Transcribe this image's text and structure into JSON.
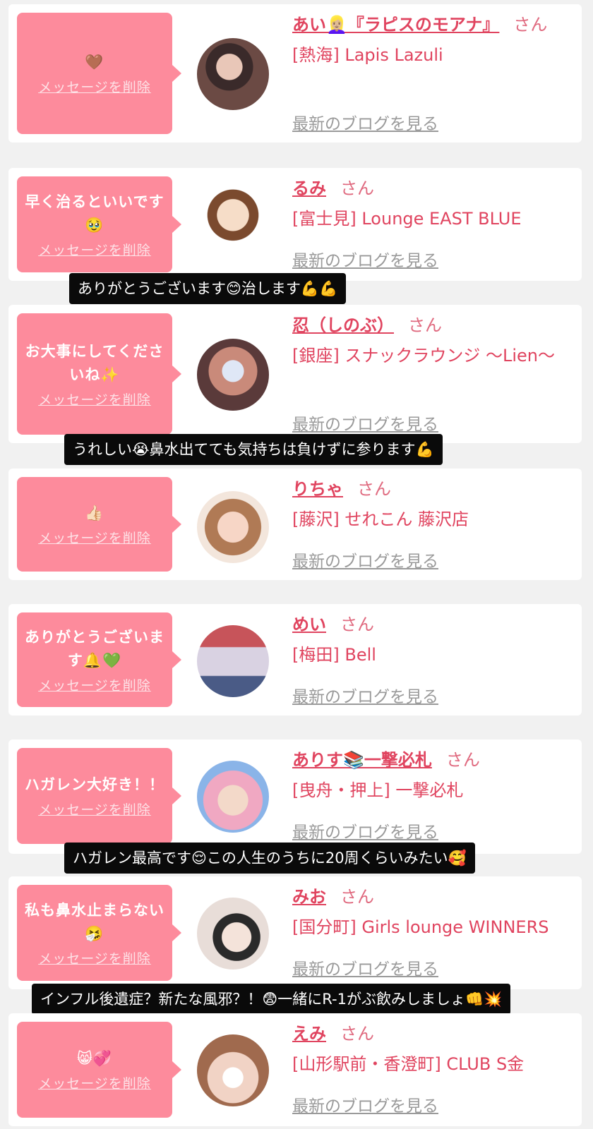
{
  "common": {
    "delete_label": "メッセージを削除",
    "blog_label": "最新のブログを見る",
    "honorific": "さん"
  },
  "entries": [
    {
      "message": "🤎",
      "name": "あい👱🏼‍♀️『ラピスのモアナ』",
      "shop": "[熱海] Lapis Lazuli"
    },
    {
      "message": "早く治るといいです🥹",
      "name": "るみ",
      "shop": "[富士見] Lounge EAST BLUE"
    },
    {
      "message": "お大事にしてくださいね✨",
      "name": "忍（しのぶ）",
      "shop": "[銀座] スナックラウンジ ～Lien～"
    },
    {
      "message": "👍🏻",
      "name": "りちゃ",
      "shop": "[藤沢] せれこん 藤沢店"
    },
    {
      "message": "ありがとうございます🔔💚",
      "name": "めい",
      "shop": "[梅田] Bell"
    },
    {
      "message": "ハガレン大好き！！",
      "name": "ありす📚一撃必札",
      "shop": "[曳舟・押上] 一撃必札"
    },
    {
      "message": "私も鼻水止まらない🤧",
      "name": "みお",
      "shop": "[国分町] Girls lounge WINNERS"
    },
    {
      "message": "😸💞",
      "name": "えみ",
      "shop": "[山形駅前・香澄町] CLUB S金"
    }
  ],
  "overlays": [
    {
      "text": "ありがとうございます😊治します💪💪"
    },
    {
      "text": "うれしい😭鼻水出てても気持ちは負けずに参ります💪"
    },
    {
      "text": "ハガレン最高です😌この人生のうちに20周くらいみたい🥰"
    },
    {
      "text": "インフル後遺症？新たな風邪？！😨一緒にR-1がぶ飲みしましょ👊💥"
    }
  ],
  "colors": {
    "bubble": "#fd8b9c",
    "name": "#e0445f",
    "link_gray": "#9a9a9a",
    "overlay_bg": "#0a0a0a"
  }
}
